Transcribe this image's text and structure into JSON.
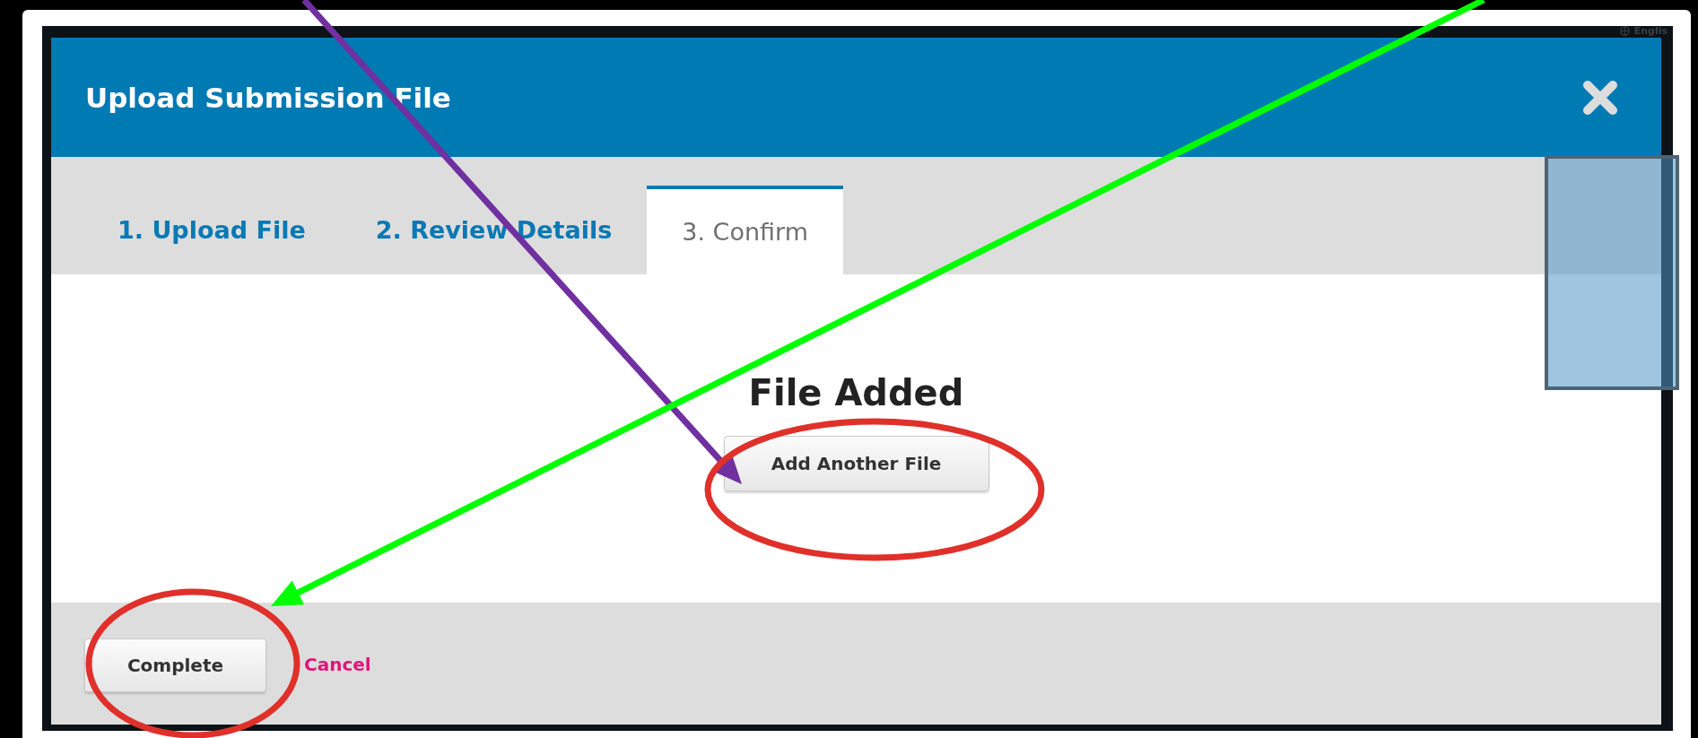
{
  "background": {
    "language_link": "Englis"
  },
  "modal": {
    "title": "Upload Submission File",
    "tabs": [
      {
        "label": "1. Upload File",
        "selected": false
      },
      {
        "label": "2. Review Details",
        "selected": false
      },
      {
        "label": "3. Confirm",
        "selected": true
      }
    ],
    "body": {
      "heading": "File Added",
      "button": "Add Another File"
    },
    "footer": {
      "primary_button": "Complete",
      "cancel_link": "Cancel"
    }
  },
  "annotations": [
    {
      "kind": "arrow",
      "color": "#7030a0"
    },
    {
      "kind": "arrow",
      "color": "#00ff00"
    },
    {
      "kind": "ellipse",
      "color": "#e0302a"
    },
    {
      "kind": "ellipse",
      "color": "#e0302a"
    },
    {
      "kind": "box",
      "color": "#4d6473"
    }
  ]
}
